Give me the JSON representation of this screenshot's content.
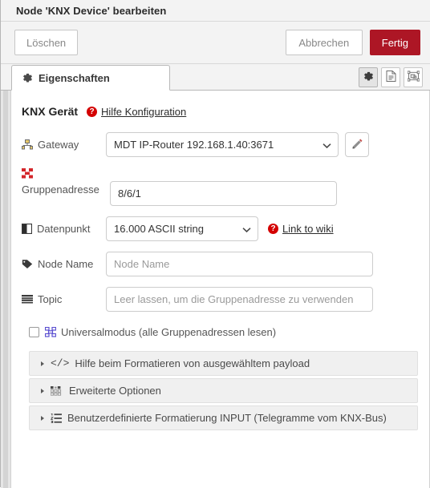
{
  "window": {
    "title": "Node 'KNX Device' bearbeiten"
  },
  "actions": {
    "delete_label": "Löschen",
    "cancel_label": "Abbrechen",
    "done_label": "Fertig",
    "done_color": "#ad1625"
  },
  "tabs": [
    {
      "label": "Eigenschaften",
      "icon": "gear-icon",
      "active": true
    }
  ],
  "tab_tools": [
    {
      "name": "properties-tool",
      "icon": "gear-icon",
      "active": true
    },
    {
      "name": "description-tool",
      "icon": "file-icon",
      "active": false
    },
    {
      "name": "appearance-tool",
      "icon": "object-group-icon",
      "active": false
    }
  ],
  "form": {
    "heading": "KNX Gerät",
    "help_link": "Hilfe Konfiguration",
    "help_icon_color": "#d40000",
    "gateway": {
      "label": "Gateway",
      "icon": "sitemap-icon",
      "value": "MDT IP-Router 192.168.1.40:3671",
      "options": [
        "MDT IP-Router 192.168.1.40:3671"
      ],
      "edit_button_icon": "pencil-icon"
    },
    "group_address": {
      "label": "Gruppenadresse",
      "icon": "th-grid-icon",
      "icon_color": "#d4262a",
      "value": "8/6/1",
      "placeholder": ""
    },
    "datapoint": {
      "label": "Datenpunkt",
      "icon": "adjust-icon",
      "value": "16.000 ASCII string",
      "options": [
        "16.000 ASCII string"
      ],
      "wiki_link": "Link to wiki"
    },
    "node_name": {
      "label": "Node Name",
      "icon": "tag-icon",
      "value": "",
      "placeholder": "Node Name"
    },
    "topic": {
      "label": "Topic",
      "icon": "list-icon",
      "value": "",
      "placeholder": "Leer lassen, um die Gruppenadresse zu verwenden"
    },
    "universal_mode": {
      "label": "Universalmodus (alle Gruppenadressen lesen)",
      "icon": "th-grid-icon",
      "icon_color": "#5b4fd0",
      "checked": false
    }
  },
  "panels": [
    {
      "label": "Hilfe beim Formatieren von ausgewähltem payload",
      "icon": "code-icon",
      "expanded": false
    },
    {
      "label": "Erweiterte Optionen",
      "icon": "th-list-icon",
      "expanded": false
    },
    {
      "label": "Benutzerdefinierte Formatierung INPUT (Telegramme vom KNX-Bus)",
      "icon": "list-ol-icon",
      "expanded": false
    }
  ]
}
